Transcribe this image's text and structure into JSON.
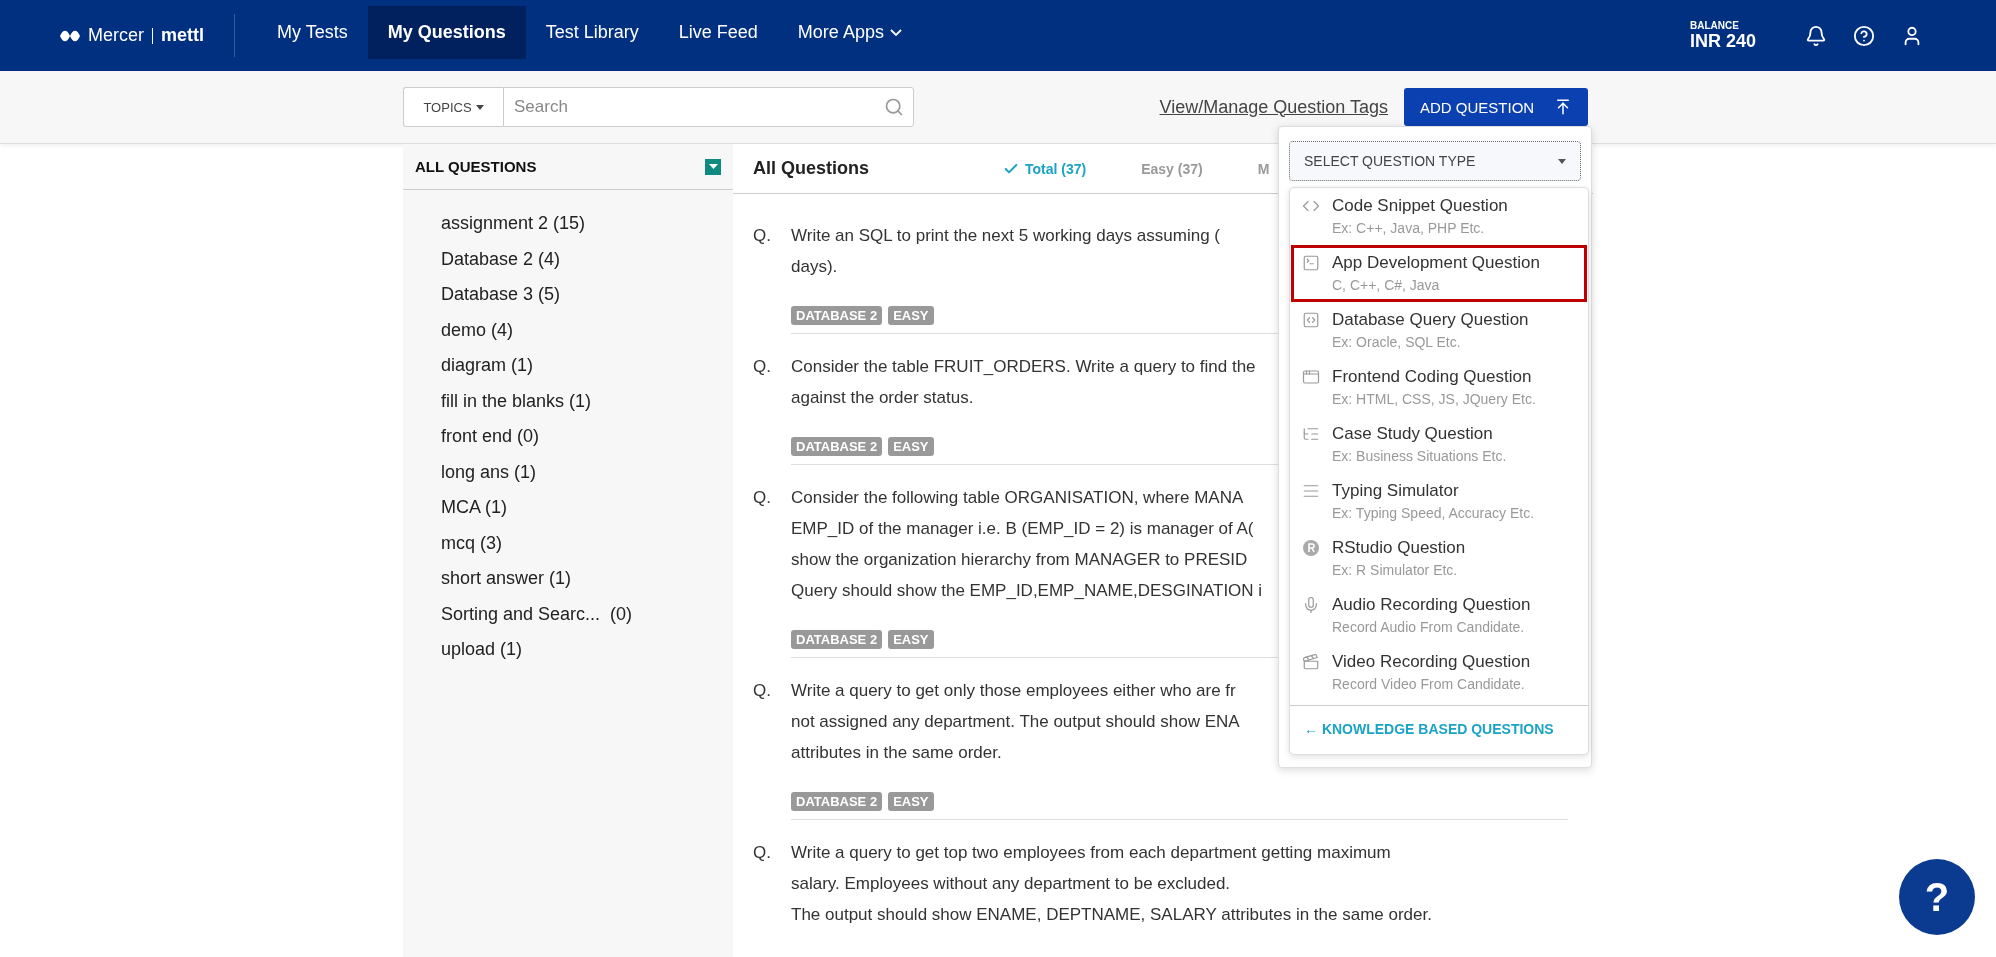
{
  "header": {
    "logo_brand": "Mercer",
    "logo_product": "mettl",
    "nav": [
      {
        "label": "My Tests",
        "selected": false,
        "kind": "link"
      },
      {
        "label": "My Questions",
        "selected": true,
        "kind": "link"
      },
      {
        "label": "Test Library",
        "selected": false,
        "kind": "link"
      },
      {
        "label": "Live Feed",
        "selected": false,
        "kind": "link"
      },
      {
        "label": "More Apps",
        "selected": false,
        "kind": "dropdown"
      }
    ],
    "balance_label": "BALANCE",
    "balance_value": "INR 240"
  },
  "toolbar": {
    "topics": "TOPICS",
    "search_placeholder": "Search",
    "tags_link": "View/Manage Question Tags",
    "add_button": "ADD QUESTION"
  },
  "sidebar": {
    "title": "ALL QUESTIONS",
    "items": [
      "assignment 2 (15)",
      "Database 2 (4)",
      "Database 3 (5)",
      "demo (4)",
      "diagram (1)",
      "fill in the blanks (1)",
      "front end (0)",
      "long ans (1)",
      "MCA (1)",
      "mcq (3)",
      "short answer (1)",
      "Sorting and Searc...  (0)",
      "upload (1)"
    ]
  },
  "content": {
    "title": "All Questions",
    "filters": [
      {
        "label": "Total (37)",
        "selected": true
      },
      {
        "label": "Easy (37)",
        "selected": false
      },
      {
        "label": "M",
        "selected": false
      }
    ],
    "questions": [
      {
        "prefix": "Q.",
        "lines": [
          "Write an SQL to print the next 5 working days assuming (",
          "days)."
        ],
        "tags": [
          "DATABASE 2",
          "EASY"
        ]
      },
      {
        "prefix": "Q.",
        "lines": [
          "Consider the table FRUIT_ORDERS. Write a query to find the",
          "against the order status."
        ],
        "tags": [
          "DATABASE 2",
          "EASY"
        ]
      },
      {
        "prefix": "Q.",
        "lines": [
          "Consider the following table ORGANISATION, where MANA",
          "EMP_ID of the manager i.e. B (EMP_ID = 2) is manager of A(",
          "show the organization hierarchy from MANAGER to PRESID",
          "Query should show the EMP_ID,EMP_NAME,DESGINATION i"
        ],
        "tags": [
          "DATABASE 2",
          "EASY"
        ]
      },
      {
        "prefix": "Q.",
        "lines": [
          "Write a query to get only those employees either who are fr",
          "not assigned any department. The output should show ENA",
          "attributes in the same order."
        ],
        "tags": [
          "DATABASE 2",
          "EASY"
        ]
      },
      {
        "prefix": "Q.",
        "lines": [
          "Write a query to get top two employees from each department getting maximum",
          "salary. Employees without any department to be excluded.",
          "The output should show ENAME, DEPTNAME, SALARY attributes in the same order."
        ]
      }
    ]
  },
  "question_type_menu": {
    "select_label": "SELECT QUESTION TYPE",
    "items": [
      {
        "kind": "code",
        "title": "Code Snippet Question",
        "subtitle": "Ex: C++, Java, PHP Etc.",
        "highlighted": false
      },
      {
        "kind": "terminal",
        "title": "App Development Question",
        "subtitle": "C, C++, C#, Java",
        "highlighted": true
      },
      {
        "kind": "database",
        "title": "Database Query Question",
        "subtitle": "Ex: Oracle, SQL Etc.",
        "highlighted": false
      },
      {
        "kind": "window",
        "title": "Frontend Coding Question",
        "subtitle": "Ex: HTML, CSS, JS, JQuery Etc.",
        "highlighted": false
      },
      {
        "kind": "tree",
        "title": "Case Study Question",
        "subtitle": "Ex: Business Situations Etc.",
        "highlighted": false
      },
      {
        "kind": "lines",
        "title": "Typing Simulator",
        "subtitle": "Ex: Typing Speed, Accuracy Etc.",
        "highlighted": false
      },
      {
        "kind": "badge",
        "title": "RStudio Question",
        "subtitle": "Ex: R Simulator Etc.",
        "highlighted": false
      },
      {
        "kind": "mic",
        "title": "Audio Recording Question",
        "subtitle": "Record Audio From Candidate.",
        "highlighted": false
      },
      {
        "kind": "video",
        "title": "Video Recording Question",
        "subtitle": "Record Video From Candidate.",
        "highlighted": false
      }
    ],
    "footer_link": "← KNOWLEDGE BASED QUESTIONS"
  },
  "help_button": "?"
}
